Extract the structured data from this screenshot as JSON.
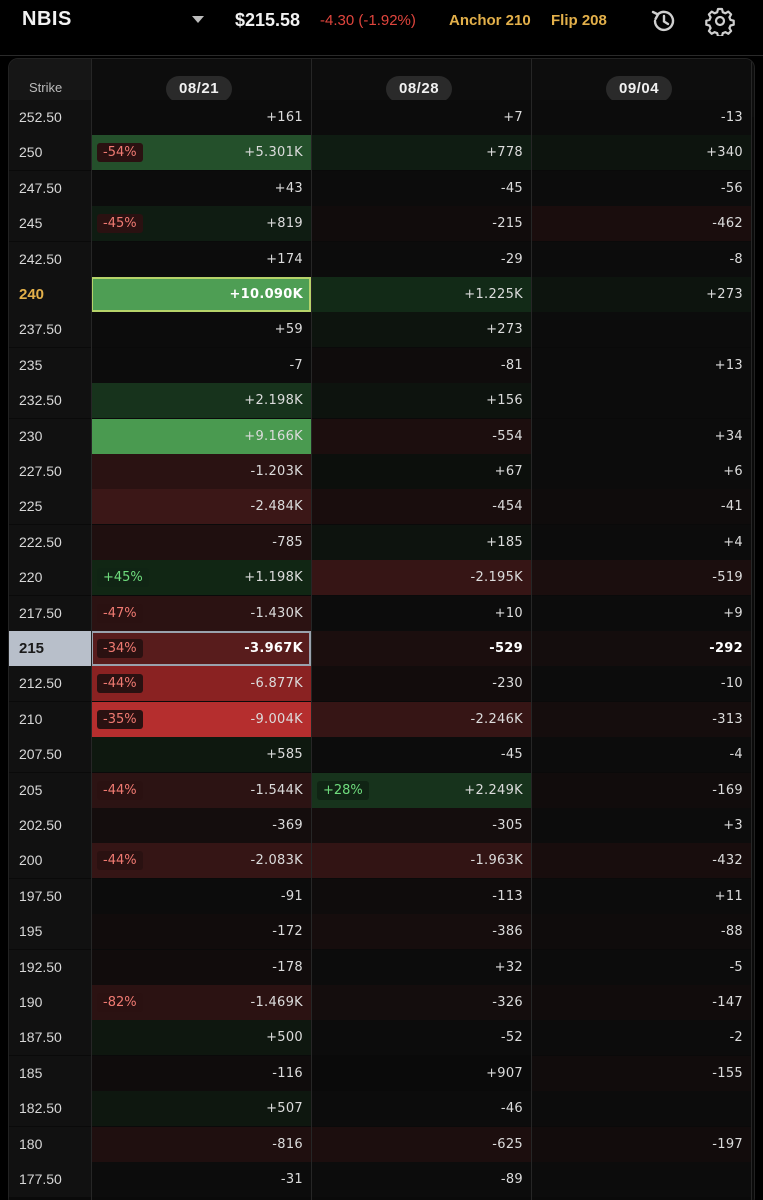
{
  "header": {
    "ticker": "NBIS",
    "price": "$215.58",
    "change": "-4.30 (-1.92%)",
    "anchor": "Anchor 210",
    "flip": "Flip 208"
  },
  "columns": {
    "strike_label": "Strike",
    "dates": [
      "08/21",
      "08/28",
      "09/04"
    ]
  },
  "colors": {
    "gold": "#e3b04a",
    "negative": "#e0453d",
    "positive_text": "#6fdc7d"
  },
  "rows": [
    {
      "strike": "252.50",
      "cells": [
        {
          "v": "+161",
          "bg": "#0c0c0c"
        },
        {
          "v": "+7",
          "bg": "#0c0c0c"
        },
        {
          "v": "-13",
          "bg": "#0c0c0c"
        }
      ]
    },
    {
      "strike": "250",
      "cells": [
        {
          "v": "+5.301K",
          "bg": "#24502b",
          "pct": "-54%",
          "pt": "neg"
        },
        {
          "v": "+778",
          "bg": "#0f1c12"
        },
        {
          "v": "+340",
          "bg": "#0d140e"
        }
      ]
    },
    {
      "strike": "247.50",
      "cells": [
        {
          "v": "+43",
          "bg": "#0c0c0c"
        },
        {
          "v": "-45",
          "bg": "#0c0c0c"
        },
        {
          "v": "-56",
          "bg": "#0c0c0c"
        }
      ]
    },
    {
      "strike": "245",
      "cells": [
        {
          "v": "+819",
          "bg": "#0f1c12",
          "pct": "-45%",
          "pt": "neg"
        },
        {
          "v": "-215",
          "bg": "#110c0c"
        },
        {
          "v": "-462",
          "bg": "#1a0d0d"
        }
      ]
    },
    {
      "strike": "242.50",
      "cells": [
        {
          "v": "+174",
          "bg": "#0c0c0c"
        },
        {
          "v": "-29",
          "bg": "#0c0c0c"
        },
        {
          "v": "-8",
          "bg": "#0c0c0c"
        }
      ]
    },
    {
      "strike": "240",
      "gold": true,
      "cells": [
        {
          "v": "+10.090K",
          "bg": "#4e9e54",
          "bold": true,
          "sel": "green"
        },
        {
          "v": "+1.225K",
          "bg": "#122a17"
        },
        {
          "v": "+273",
          "bg": "#0d140e"
        }
      ]
    },
    {
      "strike": "237.50",
      "cells": [
        {
          "v": "+59",
          "bg": "#0c0c0c"
        },
        {
          "v": "+273",
          "bg": "#0d140e"
        },
        {
          "v": "",
          "bg": "#0c0c0c"
        }
      ]
    },
    {
      "strike": "235",
      "cells": [
        {
          "v": "-7",
          "bg": "#0c0c0c"
        },
        {
          "v": "-81",
          "bg": "#0f0c0c"
        },
        {
          "v": "+13",
          "bg": "#0c0c0c"
        }
      ]
    },
    {
      "strike": "232.50",
      "cells": [
        {
          "v": "+2.198K",
          "bg": "#17331c"
        },
        {
          "v": "+156",
          "bg": "#0d130e"
        },
        {
          "v": "",
          "bg": "#0c0c0c"
        }
      ]
    },
    {
      "strike": "230",
      "cells": [
        {
          "v": "+9.166K",
          "bg": "#4a9a50"
        },
        {
          "v": "-554",
          "bg": "#1c0e0e"
        },
        {
          "v": "+34",
          "bg": "#0c0c0c"
        }
      ]
    },
    {
      "strike": "227.50",
      "cells": [
        {
          "v": "-1.203K",
          "bg": "#2a1212"
        },
        {
          "v": "+67",
          "bg": "#0c0f0c"
        },
        {
          "v": "+6",
          "bg": "#0c0c0c"
        }
      ]
    },
    {
      "strike": "225",
      "cells": [
        {
          "v": "-2.484K",
          "bg": "#3b1717"
        },
        {
          "v": "-454",
          "bg": "#190d0d"
        },
        {
          "v": "-41",
          "bg": "#0f0c0c"
        }
      ]
    },
    {
      "strike": "222.50",
      "cells": [
        {
          "v": "-785",
          "bg": "#1f0f0f"
        },
        {
          "v": "+185",
          "bg": "#0d130e"
        },
        {
          "v": "+4",
          "bg": "#0c0c0c"
        }
      ]
    },
    {
      "strike": "220",
      "cells": [
        {
          "v": "+1.198K",
          "bg": "#112614",
          "pct": "+45%",
          "pt": "pos"
        },
        {
          "v": "-2.195K",
          "bg": "#361515"
        },
        {
          "v": "-519",
          "bg": "#1b0e0e"
        }
      ]
    },
    {
      "strike": "217.50",
      "cells": [
        {
          "v": "-1.430K",
          "bg": "#2b1212",
          "pct": "-47%",
          "pt": "neg"
        },
        {
          "v": "+10",
          "bg": "#0c0c0c"
        },
        {
          "v": "+9",
          "bg": "#0c0c0c"
        }
      ]
    },
    {
      "strike": "215",
      "current": true,
      "cells": [
        {
          "v": "-3.967K",
          "bg": "#581c1c",
          "bold": true,
          "sel": "gray",
          "pct": "-34%",
          "pt": "neg"
        },
        {
          "v": "-529",
          "bg": "#1b0e0e",
          "bold": true
        },
        {
          "v": "-292",
          "bg": "#140d0d",
          "bold": true
        }
      ]
    },
    {
      "strike": "212.50",
      "cells": [
        {
          "v": "-6.877K",
          "bg": "#8a2222",
          "pct": "-44%",
          "pt": "neg"
        },
        {
          "v": "-230",
          "bg": "#120c0c"
        },
        {
          "v": "-10",
          "bg": "#0c0c0c"
        }
      ]
    },
    {
      "strike": "210",
      "cells": [
        {
          "v": "-9.004K",
          "bg": "#b52e2e",
          "pct": "-35%",
          "pt": "neg"
        },
        {
          "v": "-2.246K",
          "bg": "#361515"
        },
        {
          "v": "-313",
          "bg": "#150d0d"
        }
      ]
    },
    {
      "strike": "207.50",
      "cells": [
        {
          "v": "+585",
          "bg": "#0e180f"
        },
        {
          "v": "-45",
          "bg": "#0c0c0c"
        },
        {
          "v": "-4",
          "bg": "#0c0c0c"
        }
      ]
    },
    {
      "strike": "205",
      "cells": [
        {
          "v": "-1.544K",
          "bg": "#2c1313",
          "pct": "-44%",
          "pt": "neg"
        },
        {
          "v": "+2.249K",
          "bg": "#17331c",
          "pct": "+28%",
          "pt": "pos"
        },
        {
          "v": "-169",
          "bg": "#110c0c"
        }
      ]
    },
    {
      "strike": "202.50",
      "cells": [
        {
          "v": "-369",
          "bg": "#140d0d"
        },
        {
          "v": "-305",
          "bg": "#140d0d"
        },
        {
          "v": "+3",
          "bg": "#0c0c0c"
        }
      ]
    },
    {
      "strike": "200",
      "cells": [
        {
          "v": "-2.083K",
          "bg": "#351515",
          "pct": "-44%",
          "pt": "neg"
        },
        {
          "v": "-1.963K",
          "bg": "#321414"
        },
        {
          "v": "-432",
          "bg": "#180d0d"
        }
      ]
    },
    {
      "strike": "197.50",
      "cells": [
        {
          "v": "-91",
          "bg": "#0c0c0c"
        },
        {
          "v": "-113",
          "bg": "#0f0c0c"
        },
        {
          "v": "+11",
          "bg": "#0c0c0c"
        }
      ]
    },
    {
      "strike": "195",
      "cells": [
        {
          "v": "-172",
          "bg": "#110c0c"
        },
        {
          "v": "-386",
          "bg": "#160d0d"
        },
        {
          "v": "-88",
          "bg": "#0f0c0c"
        }
      ]
    },
    {
      "strike": "192.50",
      "cells": [
        {
          "v": "-178",
          "bg": "#110c0c"
        },
        {
          "v": "+32",
          "bg": "#0c0c0c"
        },
        {
          "v": "-5",
          "bg": "#0c0c0c"
        }
      ]
    },
    {
      "strike": "190",
      "cells": [
        {
          "v": "-1.469K",
          "bg": "#2b1212",
          "pct": "-82%",
          "pt": "neg"
        },
        {
          "v": "-326",
          "bg": "#140d0d"
        },
        {
          "v": "-147",
          "bg": "#110c0c"
        }
      ]
    },
    {
      "strike": "187.50",
      "cells": [
        {
          "v": "+500",
          "bg": "#0e170f"
        },
        {
          "v": "-52",
          "bg": "#0c0c0c"
        },
        {
          "v": "-2",
          "bg": "#0c0c0c"
        }
      ]
    },
    {
      "strike": "185",
      "cells": [
        {
          "v": "-116",
          "bg": "#0f0c0c"
        },
        {
          "v": "+907",
          "bg": "#10201"
        },
        {
          "v": "-155",
          "bg": "#110c0c"
        }
      ]
    },
    {
      "strike": "182.50",
      "cells": [
        {
          "v": "+507",
          "bg": "#0e170f"
        },
        {
          "v": "-46",
          "bg": "#0c0c0c"
        },
        {
          "v": "",
          "bg": "#0c0c0c"
        }
      ]
    },
    {
      "strike": "180",
      "cells": [
        {
          "v": "-816",
          "bg": "#1f0f0f"
        },
        {
          "v": "-625",
          "bg": "#1c0e0e"
        },
        {
          "v": "-197",
          "bg": "#120c0c"
        }
      ]
    },
    {
      "strike": "177.50",
      "cells": [
        {
          "v": "-31",
          "bg": "#0c0c0c"
        },
        {
          "v": "-89",
          "bg": "#0c0c0c"
        },
        {
          "v": "",
          "bg": "#0c0c0c"
        }
      ]
    }
  ]
}
